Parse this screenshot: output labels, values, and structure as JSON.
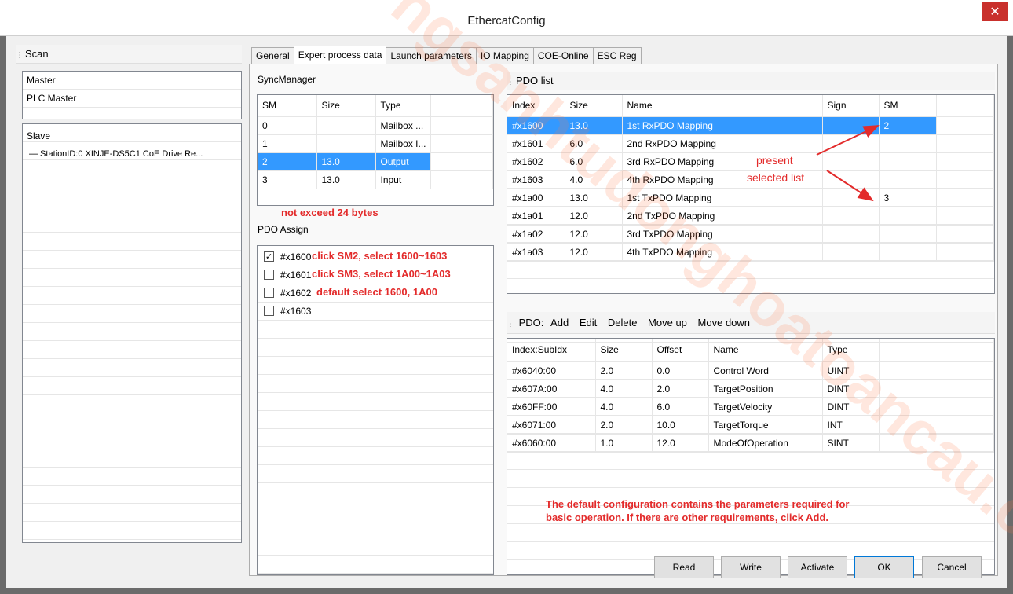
{
  "window": {
    "title": "EthercatConfig",
    "close_glyph": "✕"
  },
  "left": {
    "scan_label": "Scan",
    "master_items": [
      "Master",
      "PLC Master"
    ],
    "slave_header": "Slave",
    "slave_node": "— StationID:0 XINJE-DS5C1 CoE Drive Re..."
  },
  "tabs": [
    "General",
    "Expert process data",
    "Launch parameters",
    "IO Mapping",
    "COE-Online",
    "ESC Reg"
  ],
  "syncmanager": {
    "label": "SyncManager",
    "columns": [
      "SM",
      "Size",
      "Type"
    ],
    "rows": [
      [
        "0",
        "",
        "Mailbox ..."
      ],
      [
        "1",
        "",
        "Mailbox I..."
      ],
      [
        "2",
        "13.0",
        "Output"
      ],
      [
        "3",
        "13.0",
        "Input"
      ]
    ],
    "selected_row": 2
  },
  "pdo_assign": {
    "label": "PDO Assign",
    "items": [
      {
        "label": "#x1600",
        "checked": true,
        "check_glyph": "✓"
      },
      {
        "label": "#x1601",
        "checked": false
      },
      {
        "label": "#x1602",
        "checked": false
      },
      {
        "label": "#x1603",
        "checked": false
      }
    ]
  },
  "pdo_list": {
    "label": "PDO list",
    "columns": [
      "Index",
      "Size",
      "Name",
      "Sign",
      "SM"
    ],
    "rows": [
      [
        "#x1600",
        "13.0",
        "1st RxPDO Mapping",
        "",
        "2"
      ],
      [
        "#x1601",
        "6.0",
        "2nd RxPDO Mapping",
        "",
        ""
      ],
      [
        "#x1602",
        "6.0",
        "3rd RxPDO Mapping",
        "",
        ""
      ],
      [
        "#x1603",
        "4.0",
        "4th RxPDO Mapping",
        "",
        ""
      ],
      [
        "#x1a00",
        "13.0",
        "1st TxPDO Mapping",
        "",
        "3"
      ],
      [
        "#x1a01",
        "12.0",
        "2nd TxPDO Mapping",
        "",
        ""
      ],
      [
        "#x1a02",
        "12.0",
        "3rd TxPDO Mapping",
        "",
        ""
      ],
      [
        "#x1a03",
        "12.0",
        "4th TxPDO Mapping",
        "",
        ""
      ]
    ],
    "selected_row": 0
  },
  "pdo_toolbar": {
    "prefix": "PDO:",
    "add": "Add",
    "edit": "Edit",
    "delete": "Delete",
    "move_up": "Move up",
    "move_down": "Move down"
  },
  "pdo_entries": {
    "columns": [
      "Index:SubIdx",
      "Size",
      "Offset",
      "Name",
      "Type"
    ],
    "rows": [
      [
        "#x6040:00",
        "2.0",
        "0.0",
        "Control Word",
        "UINT"
      ],
      [
        "#x607A:00",
        "4.0",
        "2.0",
        "TargetPosition",
        "DINT"
      ],
      [
        "#x60FF:00",
        "4.0",
        "6.0",
        "TargetVelocity",
        "DINT"
      ],
      [
        "#x6071:00",
        "2.0",
        "10.0",
        "TargetTorque",
        "INT"
      ],
      [
        "#x6060:00",
        "1.0",
        "12.0",
        "ModeOfOperation",
        "SINT"
      ]
    ]
  },
  "annotations": {
    "not_exceed": "not exceed 24 bytes",
    "click_sm2": "click SM2, select 1600~1603",
    "click_sm3": "click SM3, select 1A00~1A03",
    "default_select": "default select 1600, 1A00",
    "present": "present",
    "selected_list": "selected list",
    "default_config_line1": "The default configuration contains the parameters required for",
    "default_config_line2": "basic operation. If there are other requirements, click Add.",
    "color": "#e32b2b"
  },
  "watermark": "ngsanhtudonghoatoancau.co",
  "buttons": {
    "read": "Read",
    "write": "Write",
    "activate": "Activate",
    "ok": "OK",
    "cancel": "Cancel"
  }
}
